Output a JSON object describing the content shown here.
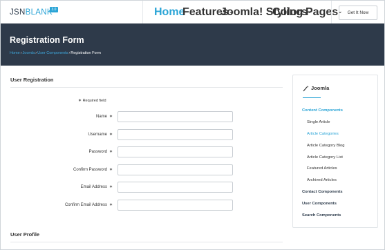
{
  "logo": {
    "part1": "JSN",
    "part2": "BLANK",
    "badge": "3.0"
  },
  "nav": {
    "items": [
      {
        "label": "Home",
        "has_dropdown": false,
        "active": true
      },
      {
        "label": "Features",
        "has_dropdown": true,
        "active": false
      },
      {
        "label": "Joomla! Styling",
        "has_dropdown": true,
        "active": false
      },
      {
        "label": "Colors",
        "has_dropdown": true,
        "active": false
      },
      {
        "label": "Pages",
        "has_dropdown": true,
        "active": false
      }
    ],
    "cta": "Get It Now"
  },
  "banner": {
    "title": "Registration Form",
    "breadcrumb": [
      {
        "label": "Home",
        "link": true
      },
      {
        "label": "Joomla",
        "link": true
      },
      {
        "label": "User Components",
        "link": true
      },
      {
        "label": "Registration Form",
        "link": false
      }
    ],
    "separator": "›"
  },
  "form": {
    "section_title": "User Registration",
    "required_star": "∗",
    "required_note": "Required field",
    "fields": [
      {
        "label": "Name",
        "value": ""
      },
      {
        "label": "Username",
        "value": ""
      },
      {
        "label": "Password",
        "value": ""
      },
      {
        "label": "Confirm Password",
        "value": ""
      },
      {
        "label": "Email Address",
        "value": ""
      },
      {
        "label": "Confirm Email Address",
        "value": ""
      }
    ],
    "profile_title": "User Profile"
  },
  "sidebar": {
    "title": "Joomla",
    "icon": "magic-wand-icon",
    "items": [
      {
        "label": "Content Components",
        "level": 0,
        "active": true
      },
      {
        "label": "Single Article",
        "level": 1,
        "active": false
      },
      {
        "label": "Article Categories",
        "level": 1,
        "active": true
      },
      {
        "label": "Article Category Blog",
        "level": 1,
        "active": false
      },
      {
        "label": "Article Category List",
        "level": 1,
        "active": false
      },
      {
        "label": "Featured Articles",
        "level": 1,
        "active": false
      },
      {
        "label": "Archived Articles",
        "level": 1,
        "active": false
      },
      {
        "label": "Contact Components",
        "level": 0,
        "active": false
      },
      {
        "label": "User Components",
        "level": 0,
        "active": false
      },
      {
        "label": "Search Components",
        "level": 0,
        "active": false
      }
    ]
  },
  "colors": {
    "accent": "#2aa4d6",
    "banner_bg": "#2e3a4a",
    "text": "#333333",
    "border": "#c9ced3"
  }
}
